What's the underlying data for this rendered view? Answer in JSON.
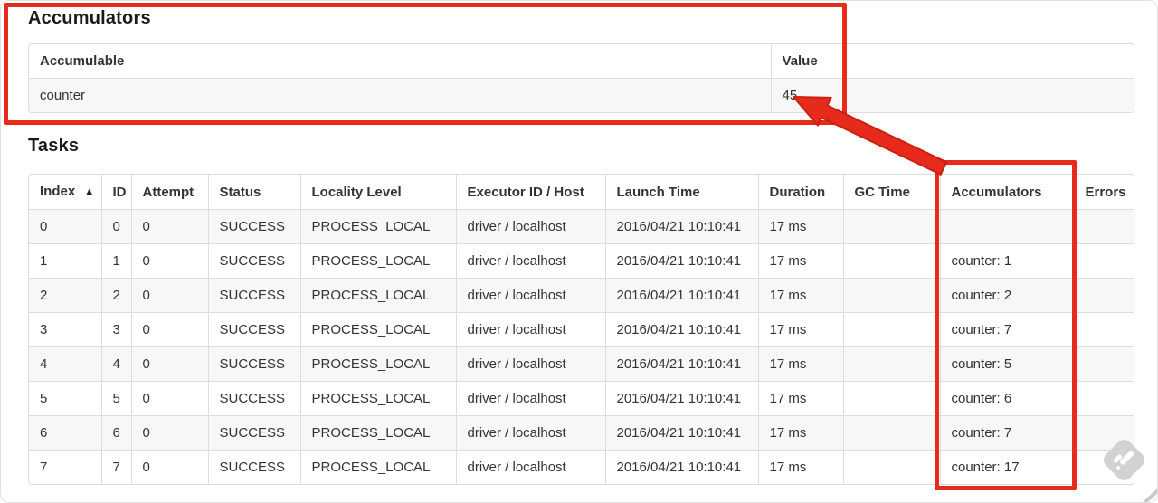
{
  "colors": {
    "annotation_red": "#e62a1c",
    "table_border": "#dddddd",
    "row_stripe": "#f7f7f7",
    "watermark_gray": "#d2d2d2",
    "text": "#333333"
  },
  "accumulators_section": {
    "title": "Accumulators",
    "table": {
      "headers": [
        "Accumulable",
        "Value"
      ],
      "rows": [
        [
          "counter",
          "45"
        ]
      ]
    }
  },
  "tasks_section": {
    "title": "Tasks",
    "table": {
      "headers": [
        "Index",
        "ID",
        "Attempt",
        "Status",
        "Locality Level",
        "Executor ID / Host",
        "Launch Time",
        "Duration",
        "GC Time",
        "Accumulators",
        "Errors"
      ],
      "sort_icon": "▲",
      "rows": [
        [
          "0",
          "0",
          "0",
          "SUCCESS",
          "PROCESS_LOCAL",
          "driver / localhost",
          "2016/04/21 10:10:41",
          "17 ms",
          "",
          "",
          ""
        ],
        [
          "1",
          "1",
          "0",
          "SUCCESS",
          "PROCESS_LOCAL",
          "driver / localhost",
          "2016/04/21 10:10:41",
          "17 ms",
          "",
          "counter: 1",
          ""
        ],
        [
          "2",
          "2",
          "0",
          "SUCCESS",
          "PROCESS_LOCAL",
          "driver / localhost",
          "2016/04/21 10:10:41",
          "17 ms",
          "",
          "counter: 2",
          ""
        ],
        [
          "3",
          "3",
          "0",
          "SUCCESS",
          "PROCESS_LOCAL",
          "driver / localhost",
          "2016/04/21 10:10:41",
          "17 ms",
          "",
          "counter: 7",
          ""
        ],
        [
          "4",
          "4",
          "0",
          "SUCCESS",
          "PROCESS_LOCAL",
          "driver / localhost",
          "2016/04/21 10:10:41",
          "17 ms",
          "",
          "counter: 5",
          ""
        ],
        [
          "5",
          "5",
          "0",
          "SUCCESS",
          "PROCESS_LOCAL",
          "driver / localhost",
          "2016/04/21 10:10:41",
          "17 ms",
          "",
          "counter: 6",
          ""
        ],
        [
          "6",
          "6",
          "0",
          "SUCCESS",
          "PROCESS_LOCAL",
          "driver / localhost",
          "2016/04/21 10:10:41",
          "17 ms",
          "",
          "counter: 7",
          ""
        ],
        [
          "7",
          "7",
          "0",
          "SUCCESS",
          "PROCESS_LOCAL",
          "driver / localhost",
          "2016/04/21 10:10:41",
          "17 ms",
          "",
          "counter: 17",
          ""
        ]
      ]
    }
  }
}
